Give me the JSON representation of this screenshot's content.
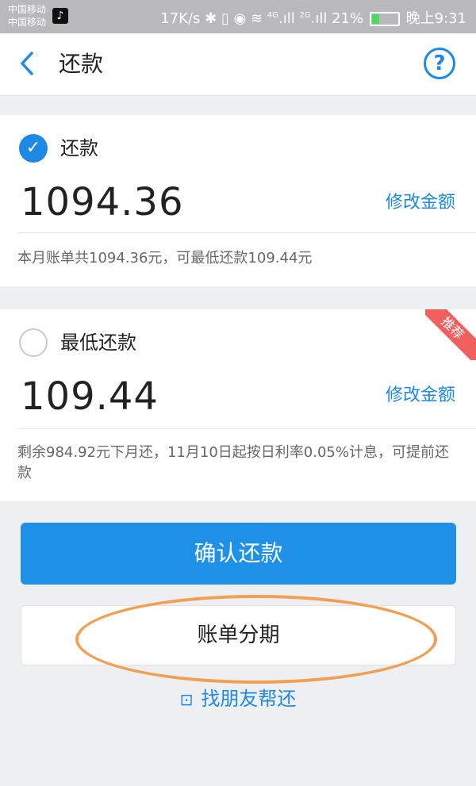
{
  "status_bar": {
    "carrier_1": "中国移动",
    "carrier_2": "中国移动",
    "network_speed": "17K/s",
    "signal_1": "4G",
    "signal_2": "2G",
    "battery": "21%",
    "time": "晚上9:31"
  },
  "header": {
    "title": "还款"
  },
  "options": [
    {
      "label": "还款",
      "selected": true,
      "amount": "1094.36",
      "edit_label": "修改金额",
      "description": "本月账单共1094.36元，可最低还款109.44元"
    },
    {
      "label": "最低还款",
      "selected": false,
      "badge": "推荐",
      "amount": "109.44",
      "edit_label": "修改金额",
      "description": "剩余984.92元下月还，11月10日起按日利率0.05%计息，可提前还款"
    }
  ],
  "actions": {
    "confirm_label": "确认还款",
    "installment_label": "账单分期",
    "friend_label": "找朋友帮还"
  },
  "colors": {
    "accent": "#1e88e5",
    "ribbon": "#f0605f",
    "highlight": "#f0a050"
  }
}
